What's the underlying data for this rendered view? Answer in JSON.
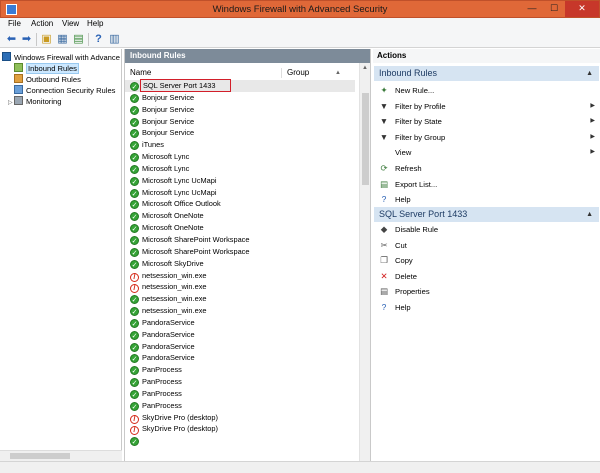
{
  "window": {
    "title": "Windows Firewall with Advanced Security",
    "minimize": "—",
    "maximize": "☐",
    "close": "✕"
  },
  "menu": [
    "File",
    "Action",
    "View",
    "Help"
  ],
  "tree": {
    "root": "Windows Firewall with Advance",
    "items": [
      "Inbound Rules",
      "Outbound Rules",
      "Connection Security Rules",
      "Monitoring"
    ]
  },
  "center": {
    "header": "Inbound Rules",
    "columns": {
      "name": "Name",
      "group": "Group"
    },
    "rows": [
      {
        "name": "SQL Server Port 1433",
        "status": "allow",
        "highlight": true
      },
      {
        "name": "Bonjour Service",
        "status": "allow"
      },
      {
        "name": "Bonjour Service",
        "status": "allow"
      },
      {
        "name": "Bonjour Service",
        "status": "allow"
      },
      {
        "name": "Bonjour Service",
        "status": "allow"
      },
      {
        "name": "iTunes",
        "status": "allow"
      },
      {
        "name": "Microsoft Lync",
        "status": "allow"
      },
      {
        "name": "Microsoft Lync",
        "status": "allow"
      },
      {
        "name": "Microsoft Lync UcMapi",
        "status": "allow"
      },
      {
        "name": "Microsoft Lync UcMapi",
        "status": "allow"
      },
      {
        "name": "Microsoft Office Outlook",
        "status": "allow"
      },
      {
        "name": "Microsoft OneNote",
        "status": "allow"
      },
      {
        "name": "Microsoft OneNote",
        "status": "allow"
      },
      {
        "name": "Microsoft SharePoint Workspace",
        "status": "allow"
      },
      {
        "name": "Microsoft SharePoint Workspace",
        "status": "allow"
      },
      {
        "name": "Microsoft SkyDrive",
        "status": "allow"
      },
      {
        "name": "netsession_win.exe",
        "status": "block"
      },
      {
        "name": "netsession_win.exe",
        "status": "block"
      },
      {
        "name": "netsession_win.exe",
        "status": "allow"
      },
      {
        "name": "netsession_win.exe",
        "status": "allow"
      },
      {
        "name": "PandoraService",
        "status": "allow"
      },
      {
        "name": "PandoraService",
        "status": "allow"
      },
      {
        "name": "PandoraService",
        "status": "allow"
      },
      {
        "name": "PandoraService",
        "status": "allow"
      },
      {
        "name": "PanProcess",
        "status": "allow"
      },
      {
        "name": "PanProcess",
        "status": "allow"
      },
      {
        "name": "PanProcess",
        "status": "allow"
      },
      {
        "name": "PanProcess",
        "status": "allow"
      },
      {
        "name": "SkyDrive Pro (desktop)",
        "status": "block"
      },
      {
        "name": "SkyDrive Pro (desktop)",
        "status": "block"
      },
      {
        "name": "",
        "status": "allow"
      }
    ]
  },
  "actions": {
    "header": "Actions",
    "section1": {
      "title": "Inbound Rules",
      "items": [
        {
          "label": "New Rule...",
          "icon": "new-rule-icon",
          "glyph": "✦",
          "submenu": false
        },
        {
          "label": "Filter by Profile",
          "icon": "filter-icon",
          "glyph": "▼",
          "submenu": true
        },
        {
          "label": "Filter by State",
          "icon": "filter-icon",
          "glyph": "▼",
          "submenu": true
        },
        {
          "label": "Filter by Group",
          "icon": "filter-icon",
          "glyph": "▼",
          "submenu": true
        },
        {
          "label": "View",
          "icon": "",
          "glyph": "",
          "submenu": true
        },
        {
          "label": "Refresh",
          "icon": "refresh-icon",
          "glyph": "⟳",
          "submenu": false
        },
        {
          "label": "Export List...",
          "icon": "export-icon",
          "glyph": "▤",
          "submenu": false
        },
        {
          "label": "Help",
          "icon": "help-icon",
          "glyph": "?",
          "submenu": false
        }
      ]
    },
    "section2": {
      "title": "SQL Server Port 1433",
      "items": [
        {
          "label": "Disable Rule",
          "icon": "disable-icon",
          "glyph": "◆",
          "color": "#444"
        },
        {
          "label": "Cut",
          "icon": "cut-icon",
          "glyph": "✂",
          "color": "#555"
        },
        {
          "label": "Copy",
          "icon": "copy-icon",
          "glyph": "❐",
          "color": "#555"
        },
        {
          "label": "Delete",
          "icon": "delete-icon",
          "glyph": "✕",
          "color": "#d21f1f"
        },
        {
          "label": "Properties",
          "icon": "properties-icon",
          "glyph": "▤",
          "color": "#555"
        },
        {
          "label": "Help",
          "icon": "help-icon",
          "glyph": "?",
          "color": "#2a62b5"
        }
      ]
    }
  },
  "colors": {
    "titlebar": "#e06838",
    "panelHeader": "#7d8b99",
    "sectionHeader": "#d6e4f2",
    "highlight": "#d21f2a"
  }
}
